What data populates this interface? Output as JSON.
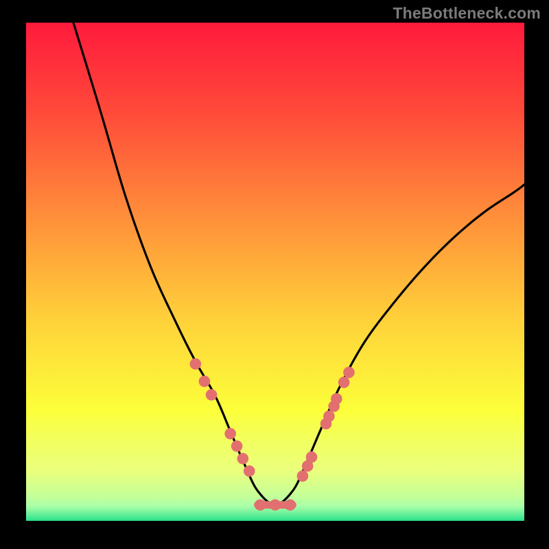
{
  "watermark": "TheBottleneck.com",
  "colors": {
    "black": "#000000",
    "curve": "#000000",
    "dot": "#e27070",
    "underline": "#e27070",
    "gradient_stops": [
      {
        "offset": 0.0,
        "color": "#ff1a3c"
      },
      {
        "offset": 0.18,
        "color": "#ff4a3a"
      },
      {
        "offset": 0.4,
        "color": "#ff923a"
      },
      {
        "offset": 0.6,
        "color": "#ffd23a"
      },
      {
        "offset": 0.78,
        "color": "#fcff3a"
      },
      {
        "offset": 0.9,
        "color": "#e4ff78"
      },
      {
        "offset": 0.97,
        "color": "#97ffb0"
      },
      {
        "offset": 1.0,
        "color": "#28e08a"
      }
    ],
    "overlay_stops": [
      {
        "offset": 0.78,
        "opacity": 0
      },
      {
        "offset": 0.88,
        "opacity": 0.22
      },
      {
        "offset": 0.95,
        "opacity": 0.3
      },
      {
        "offset": 1.0,
        "opacity": 0.0
      }
    ]
  },
  "chart_data": {
    "type": "line",
    "title": "",
    "xlabel": "",
    "ylabel": "",
    "xlim": [
      0,
      100
    ],
    "ylim": [
      0,
      100
    ],
    "grid": false,
    "note": "Bottleneck-style V-curve. Values are approximate readings from pixel positions; x is horizontal percent across plot, y is vertical percent (0 at bottom).",
    "series": [
      {
        "name": "curve",
        "x": [
          9.5,
          15,
          20,
          25,
          30,
          34,
          38,
          41,
          44,
          46.5,
          50,
          53.5,
          56,
          59,
          63,
          68,
          74,
          80,
          86,
          92,
          98,
          100
        ],
        "y": [
          100,
          82,
          65,
          51,
          40,
          32,
          25,
          18,
          11,
          6,
          3.2,
          6,
          11,
          18,
          27,
          36,
          44,
          51,
          57,
          62,
          66,
          67.5
        ]
      }
    ],
    "valley_flat_segment": {
      "x_start": 46.5,
      "x_end": 53.5,
      "y": 3.2
    },
    "scatter_dots": {
      "name": "dots",
      "x": [
        34.0,
        35.8,
        37.2,
        41.0,
        42.3,
        43.5,
        44.8,
        47.0,
        50.0,
        53.0,
        55.5,
        56.5,
        57.3,
        60.2,
        60.8,
        61.8,
        62.3,
        63.8,
        64.8
      ],
      "y": [
        31.5,
        28.0,
        25.3,
        17.5,
        15.0,
        12.5,
        10.0,
        3.2,
        3.2,
        3.2,
        9.0,
        11.0,
        12.8,
        19.5,
        21.0,
        23.0,
        24.5,
        27.8,
        29.8
      ]
    }
  }
}
